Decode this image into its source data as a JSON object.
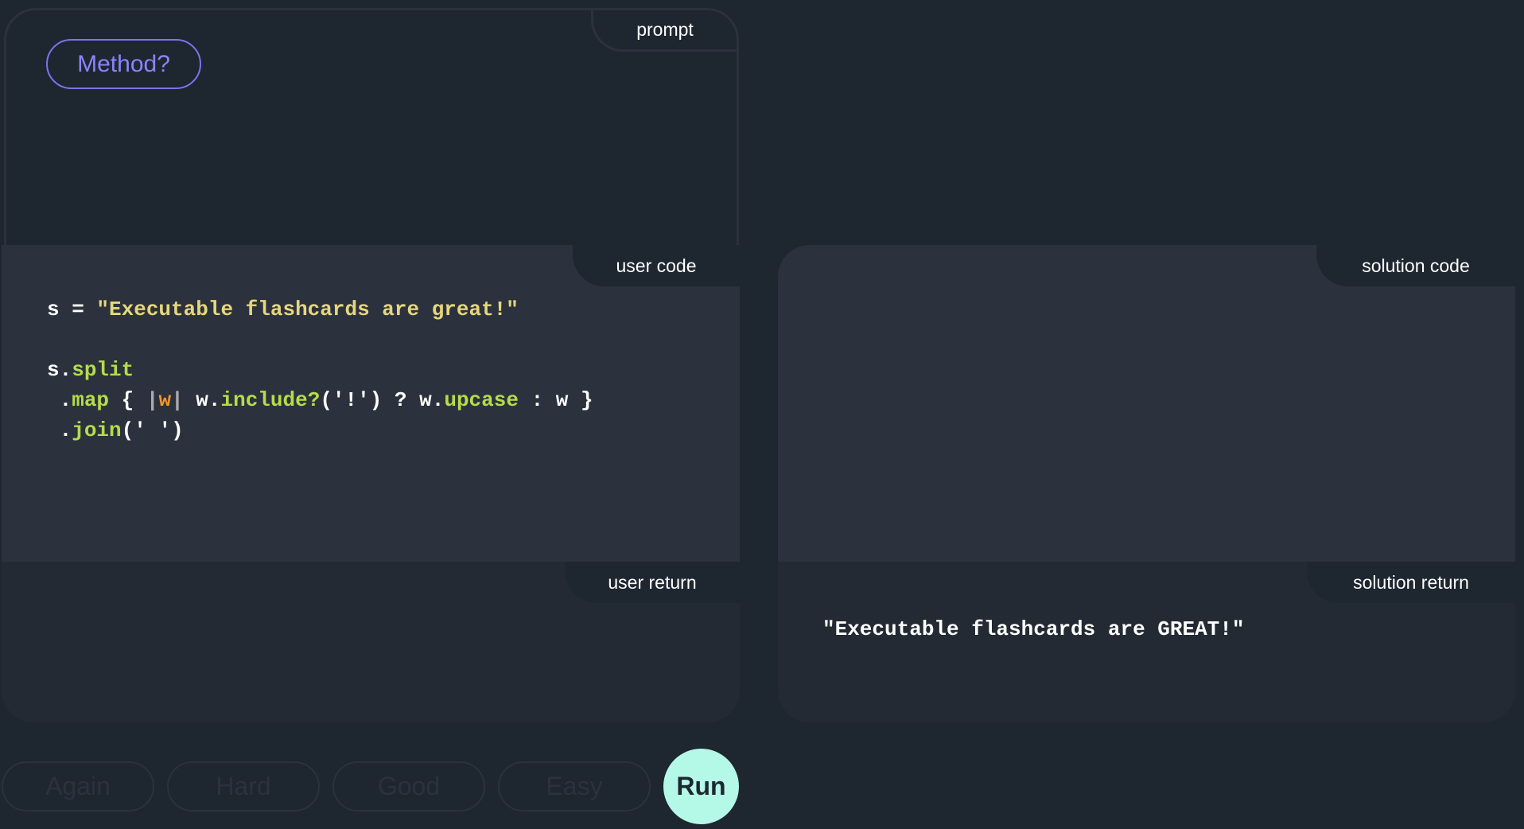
{
  "prompt": {
    "tab": "prompt",
    "method_label": "Method?"
  },
  "user_code": {
    "tab": "user code",
    "lines": {
      "l1a": "s = ",
      "l1b": "\"Executable flashcards are great!\"",
      "l3a": "s.",
      "l3b": "split",
      "l4a": " .",
      "l4b": "map",
      "l4c": " { ",
      "l4d": "|",
      "l4e": "w",
      "l4f": "|",
      "l4g": " w.",
      "l4h": "include?",
      "l4i": "('!') ? w.",
      "l4j": "upcase",
      "l4k": " : w }",
      "l5a": " .",
      "l5b": "join",
      "l5c": "('",
      "l5d": " ",
      "l5e": "')"
    }
  },
  "user_return": {
    "tab": "user return"
  },
  "solution_code": {
    "tab": "solution code"
  },
  "solution_return": {
    "tab": "solution return",
    "value": "\"Executable flashcards are GREAT!\""
  },
  "buttons": {
    "again": "Again",
    "hard": "Hard",
    "good": "Good",
    "easy": "Easy",
    "run": "Run"
  },
  "colors": {
    "background": "#1e2630",
    "code_bg": "#2b323d",
    "accent": "#7b74f0",
    "run": "#b4f8e8",
    "string": "#e6d77c",
    "method": "#b5dc4a"
  }
}
